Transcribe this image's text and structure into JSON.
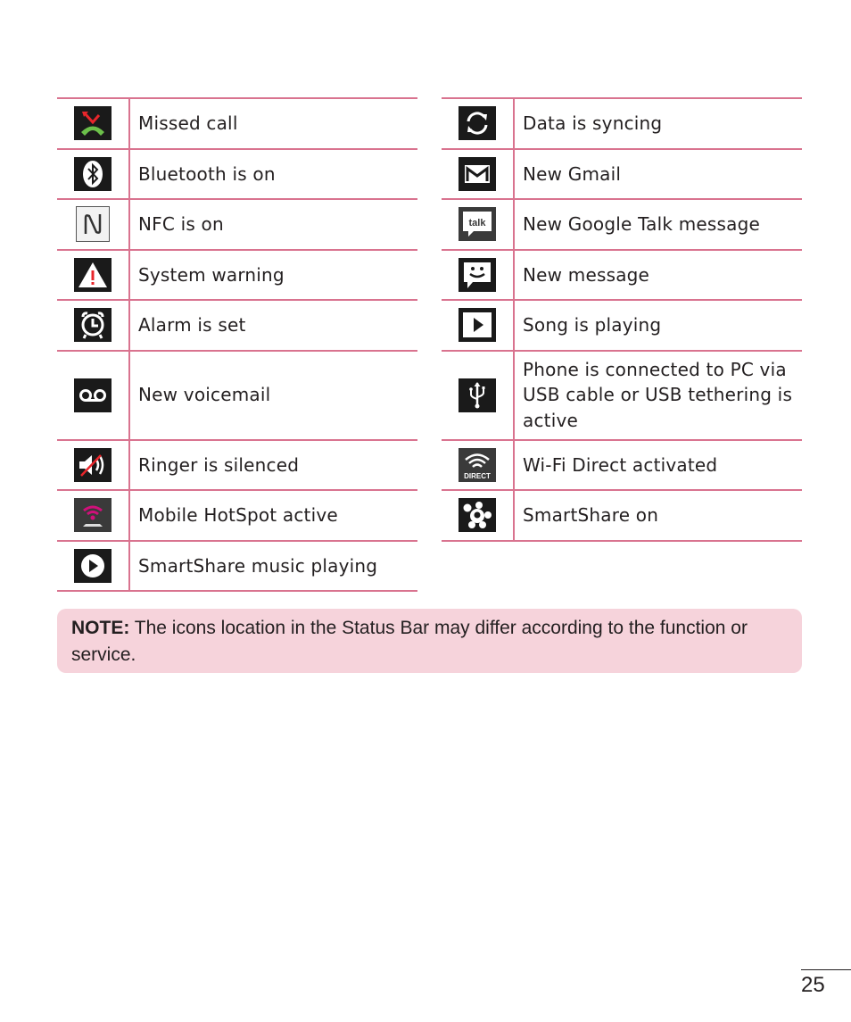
{
  "left_table": [
    {
      "icon": "missed-call-icon",
      "label": "Missed call"
    },
    {
      "icon": "bluetooth-icon",
      "label": "Bluetooth is on"
    },
    {
      "icon": "nfc-icon",
      "label": "NFC is on"
    },
    {
      "icon": "warning-icon",
      "label": "System warning"
    },
    {
      "icon": "alarm-icon",
      "label": "Alarm is set"
    },
    {
      "icon": "voicemail-icon",
      "label": "New voicemail"
    },
    {
      "icon": "ringer-silenced-icon",
      "label": "Ringer is silenced"
    },
    {
      "icon": "hotspot-icon",
      "label": "Mobile HotSpot active"
    },
    {
      "icon": "smartshare-music-icon",
      "label": "SmartShare music playing"
    }
  ],
  "right_table": [
    {
      "icon": "sync-icon",
      "label": "Data is syncing"
    },
    {
      "icon": "gmail-icon",
      "label": "New Gmail"
    },
    {
      "icon": "google-talk-icon",
      "label": "New Google Talk message",
      "icon_text": "talk"
    },
    {
      "icon": "message-icon",
      "label": "New message"
    },
    {
      "icon": "song-playing-icon",
      "label": "Song is playing"
    },
    {
      "icon": "usb-icon",
      "label": "Phone is connected to PC via USB cable or USB tethering is active"
    },
    {
      "icon": "wifi-direct-icon",
      "label": "Wi-Fi Direct activated",
      "icon_text": "DIRECT"
    },
    {
      "icon": "smartshare-icon",
      "label": "SmartShare on"
    }
  ],
  "note": {
    "prefix": "NOTE:",
    "text": " The icons location in the Status Bar may differ according to the function or service."
  },
  "page_number": "25",
  "colors": {
    "rule": "#d9738f",
    "note_bg": "#f6d3db",
    "icon_bg": "#1a1a1a",
    "hotspot_magenta": "#d0107a",
    "missed_call_green": "#6cc04a",
    "missed_call_red": "#e8262b"
  }
}
